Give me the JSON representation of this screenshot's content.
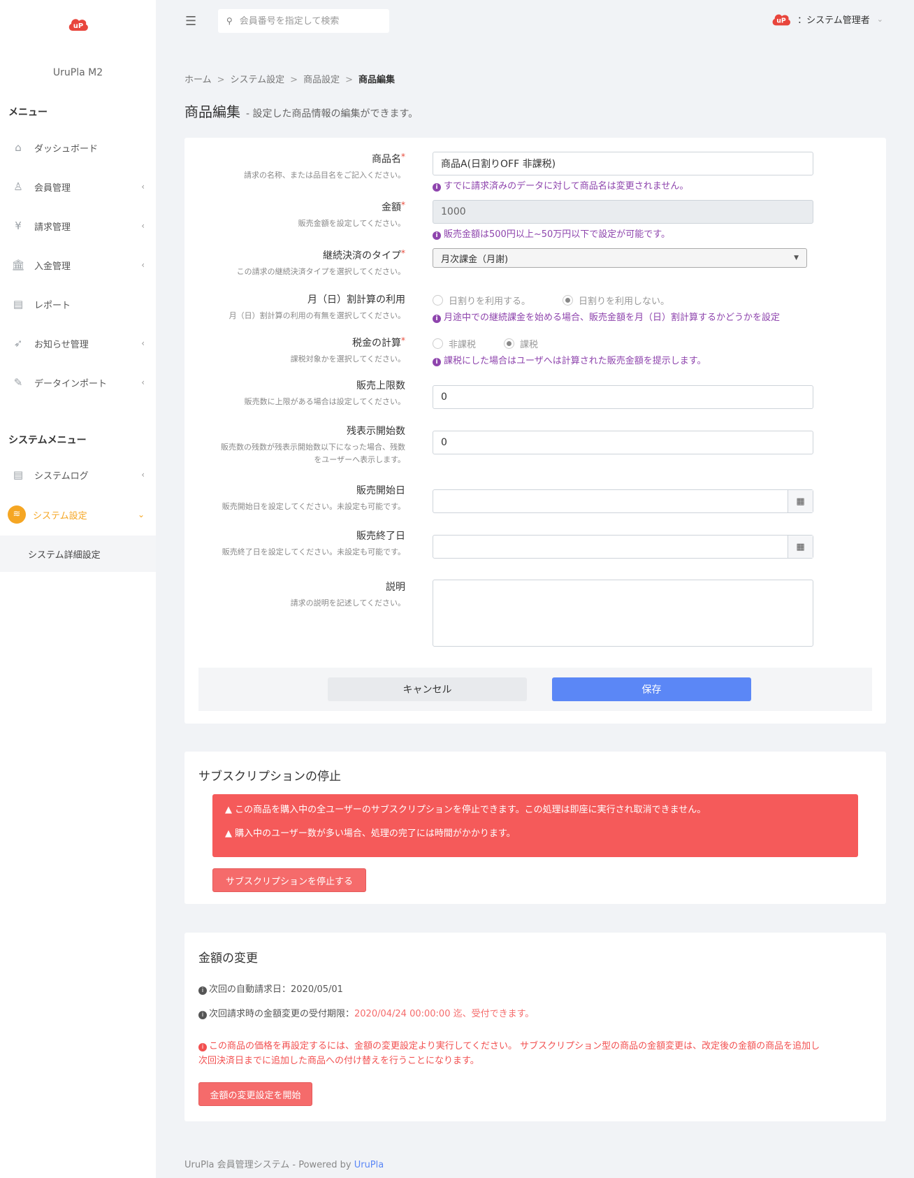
{
  "sidebar": {
    "brand": "UruPla M2",
    "menu_title": "メニュー",
    "items": [
      {
        "label": "ダッシュボード",
        "chevron": ""
      },
      {
        "label": "会員管理",
        "chevron": "‹"
      },
      {
        "label": "請求管理",
        "chevron": "‹"
      },
      {
        "label": "入金管理",
        "chevron": "‹"
      },
      {
        "label": "レポート",
        "chevron": ""
      },
      {
        "label": "お知らせ管理",
        "chevron": "‹"
      },
      {
        "label": "データインポート",
        "chevron": "‹"
      }
    ],
    "system_menu_title": "システムメニュー",
    "system_items": [
      {
        "label": "システムログ",
        "chevron": "‹"
      },
      {
        "label": "システム設定",
        "chevron": "⌄"
      }
    ],
    "sub_item": "システム詳細設定"
  },
  "topbar": {
    "search_placeholder": "会員番号を指定して検索",
    "user_label": "：システム管理者"
  },
  "breadcrumb": [
    "ホーム",
    "システム設定",
    "商品設定",
    "商品編集"
  ],
  "breadcrumb_sep": ">",
  "page": {
    "title": "商品編集",
    "subtitle": "- 設定した商品情報の編集ができます。"
  },
  "form": {
    "name": {
      "label": "商品名",
      "desc": "請求の名称、または品目名をご記入ください。",
      "value": "商品A(日割りOFF 非課税)",
      "hint": "すでに請求済みのデータに対して商品名は変更されません。"
    },
    "price": {
      "label": "金額",
      "desc": "販売金額を設定してください。",
      "value": "1000",
      "hint": "販売金額は500円以上~50万円以下で設定が可能です。"
    },
    "type": {
      "label": "継続決済のタイプ",
      "desc": "この請求の継続決済タイプを選択してください。",
      "value": "月次課金（月謝)"
    },
    "prorate": {
      "label": "月（日）割計算の利用",
      "desc": "月（日）割計算の利用の有無を選択してください。",
      "opt1": "日割りを利用する。",
      "opt2": "日割りを利用しない。",
      "hint": "月途中での継続課金を始める場合、販売金額を月（日）割計算するかどうかを設定"
    },
    "tax": {
      "label": "税金の計算",
      "desc": "課税対象かを選択してください。",
      "opt1": "非課税",
      "opt2": "課税",
      "hint": "課税にした場合はユーザへは計算された販売金額を提示します。"
    },
    "limit": {
      "label": "販売上限数",
      "desc": "販売数に上限がある場合は設定してください。",
      "value": "0"
    },
    "remain": {
      "label": "残表示開始数",
      "desc1": "販売数の残数が残表示開始数以下になった場合、残数",
      "desc2": "をユーザーへ表示します。",
      "value": "0"
    },
    "start": {
      "label": "販売開始日",
      "desc": "販売開始日を設定してください。未設定も可能です。",
      "value": ""
    },
    "end": {
      "label": "販売終了日",
      "desc": "販売終了日を設定してください。未設定も可能です。",
      "value": ""
    },
    "description": {
      "label": "説明",
      "desc": "請求の説明を記述してください。",
      "value": ""
    },
    "required_mark": "*",
    "info_mark": "i",
    "cancel": "キャンセル",
    "save": "保存"
  },
  "subscription": {
    "title": "サブスクリプションの停止",
    "warn_mark": "▲",
    "alert1": "この商品を購入中の全ユーザーのサブスクリプションを停止できます。この処理は即座に実行され取消できません。",
    "alert2": "購入中のユーザー数が多い場合、処理の完了には時間がかかります。",
    "button": "サブスクリプションを停止する"
  },
  "price_change": {
    "title": "金額の変更",
    "info_mark": "i",
    "next_label": "次回の自動請求日：",
    "next_date": "2020/05/01",
    "deadline_label": "次回請求時の金額変更の受付期限：",
    "deadline_value": "2020/04/24 00:00:00",
    "deadline_suffix": " 迄、受付できます。",
    "warn1": "この商品の価格を再設定するには、金額の変更設定より実行してください。 サブスクリプション型の商品の金額変更は、改定後の金額の商品を追加し",
    "warn2": "次回決済日までに追加した商品への付け替えを行うことになります。",
    "button": "金額の変更設定を開始"
  },
  "footer": {
    "text": "UruPla 会員管理システム - Powered by ",
    "link": "UruPla"
  },
  "colors": {
    "accent": "#5b87f6",
    "active": "#f5a623",
    "danger": "#f55a5a",
    "hint": "#8e44ad"
  }
}
